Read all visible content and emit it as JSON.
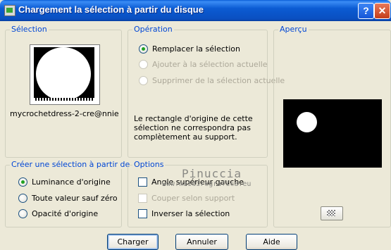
{
  "window": {
    "title": "Chargement la sélection à partir du disque",
    "help_label": "?",
    "close_label": "✕"
  },
  "selection": {
    "legend": "Sélection",
    "thumbnail_label": "mycrochetdress-2-cre@nnie"
  },
  "operation": {
    "legend": "Opération",
    "options": [
      {
        "label": "Remplacer la sélection",
        "checked": true,
        "enabled": true
      },
      {
        "label": "Ajouter à la sélection actuelle",
        "checked": false,
        "enabled": false
      },
      {
        "label": "Supprimer de la sélection actuelle",
        "checked": false,
        "enabled": false
      }
    ],
    "note": "Le rectangle d'origine de cette sélection ne correspondra pas complètement au support."
  },
  "preview": {
    "legend": "Aperçu"
  },
  "create_from": {
    "legend": "Créer une sélection à partir de :",
    "options": [
      {
        "label": "Luminance d'origine",
        "checked": true
      },
      {
        "label": "Toute valeur sauf zéro",
        "checked": false
      },
      {
        "label": "Opacité d'origine",
        "checked": false
      }
    ]
  },
  "options": {
    "legend": "Options",
    "checkboxes": [
      {
        "label": "Angle supérieur gauche",
        "checked": false,
        "enabled": true
      },
      {
        "label": "Couper selon support",
        "checked": false,
        "enabled": false
      },
      {
        "label": "Inverser la sélection",
        "checked": false,
        "enabled": true
      }
    ]
  },
  "watermark": {
    "line1": "Pinuccia",
    "line2": "www.maidiregrafica.eu"
  },
  "buttons": {
    "load": "Charger",
    "cancel": "Annuler",
    "help": "Aide"
  },
  "colors": {
    "title_bar": "#0a5fd8",
    "dialog_bg": "#ece9d8",
    "group_legend": "#0046d5",
    "radio_dot": "#21a121"
  }
}
